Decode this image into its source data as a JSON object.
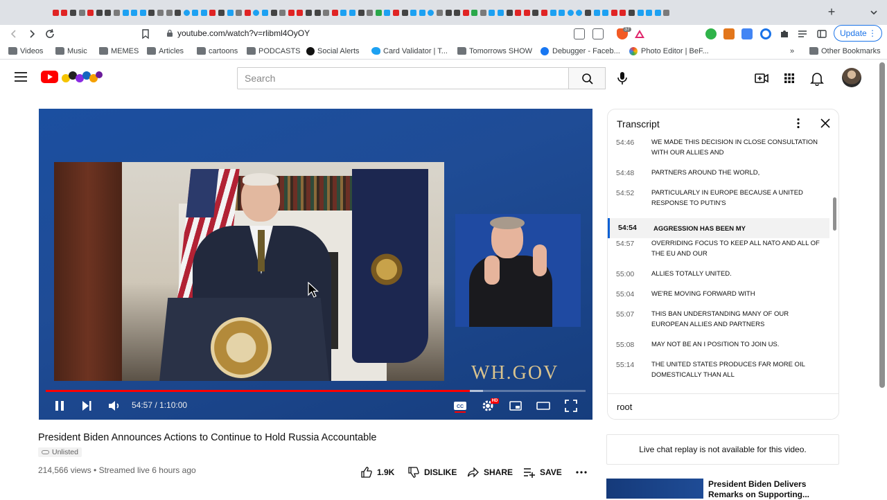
{
  "browser": {
    "url": "youtube.com/watch?v=rlibml4OyOY",
    "update_label": "Update",
    "bookmarks": [
      {
        "label": "Videos",
        "icon": "folder-icon"
      },
      {
        "label": "Music",
        "icon": "folder-icon"
      },
      {
        "label": "MEMES",
        "icon": "folder-icon"
      },
      {
        "label": "Articles",
        "icon": "folder-icon"
      },
      {
        "label": "cartoons",
        "icon": "folder-icon"
      },
      {
        "label": "PODCASTS",
        "icon": "folder-icon"
      },
      {
        "label": "Social Alerts",
        "icon": "r-icon"
      },
      {
        "label": "Card Validator | T...",
        "icon": "twitter-icon"
      },
      {
        "label": "Tomorrows SHOW",
        "icon": "folder-icon"
      },
      {
        "label": "Debugger - Faceb...",
        "icon": "facebook-icon"
      },
      {
        "label": "Photo Editor | BeF...",
        "icon": "befunky-icon"
      }
    ],
    "bookmarks_overflow": "»",
    "other_bookmarks": "Other Bookmarks",
    "extension_badge": "37"
  },
  "youtube": {
    "search_placeholder": "Search"
  },
  "player": {
    "current_time": "54:57",
    "duration": "1:10:00",
    "time_display": "54:57 / 1:10:00",
    "progress_fraction": 0.785,
    "loaded_fraction": 0.81,
    "watermark": "WH.GOV",
    "hd_badge": "HD"
  },
  "video": {
    "title": "President Biden Announces Actions to Continue to Hold Russia Accountable",
    "visibility": "Unlisted",
    "views": "214,566 views",
    "streamed": "Streamed live 6 hours ago",
    "meta_line": "214,566 views • Streamed live 6 hours ago",
    "likes": "1.9K",
    "dislike_label": "DISLIKE",
    "share_label": "SHARE",
    "save_label": "SAVE"
  },
  "transcript": {
    "title": "Transcript",
    "active_index": 3,
    "segments": [
      {
        "time": "54:46",
        "text": "WE MADE THIS DECISION IN CLOSE CONSULTATION WITH OUR ALLIES AND"
      },
      {
        "time": "54:48",
        "text": "PARTNERS AROUND THE WORLD,"
      },
      {
        "time": "54:52",
        "text": "PARTICULARLY IN EUROPE BECAUSE A UNITED RESPONSE TO PUTIN'S"
      },
      {
        "time": "54:54",
        "text": "AGGRESSION HAS BEEN MY"
      },
      {
        "time": "54:57",
        "text": "OVERRIDING FOCUS TO KEEP ALL NATO AND ALL OF THE EU AND OUR"
      },
      {
        "time": "55:00",
        "text": "ALLIES TOTALLY UNITED."
      },
      {
        "time": "55:04",
        "text": "WE'RE MOVING FORWARD WITH"
      },
      {
        "time": "55:07",
        "text": "THIS BAN UNDERSTANDING MANY OF OUR EUROPEAN ALLIES AND PARTNERS"
      },
      {
        "time": "55:08",
        "text": "MAY NOT BE AN I POSITION TO JOIN US."
      },
      {
        "time": "55:14",
        "text": "THE UNITED STATES PRODUCES FAR MORE OIL DOMESTICALLY THAN ALL"
      }
    ],
    "footer_text": "root"
  },
  "sidebar": {
    "live_chat_notice": "Live chat replay is not available for this video.",
    "recommended_title": "President Biden Delivers Remarks on Supporting..."
  },
  "colors": {
    "yt_red": "#ff0000",
    "active_blue": "#065fd4",
    "update_blue": "#1a73e8"
  }
}
